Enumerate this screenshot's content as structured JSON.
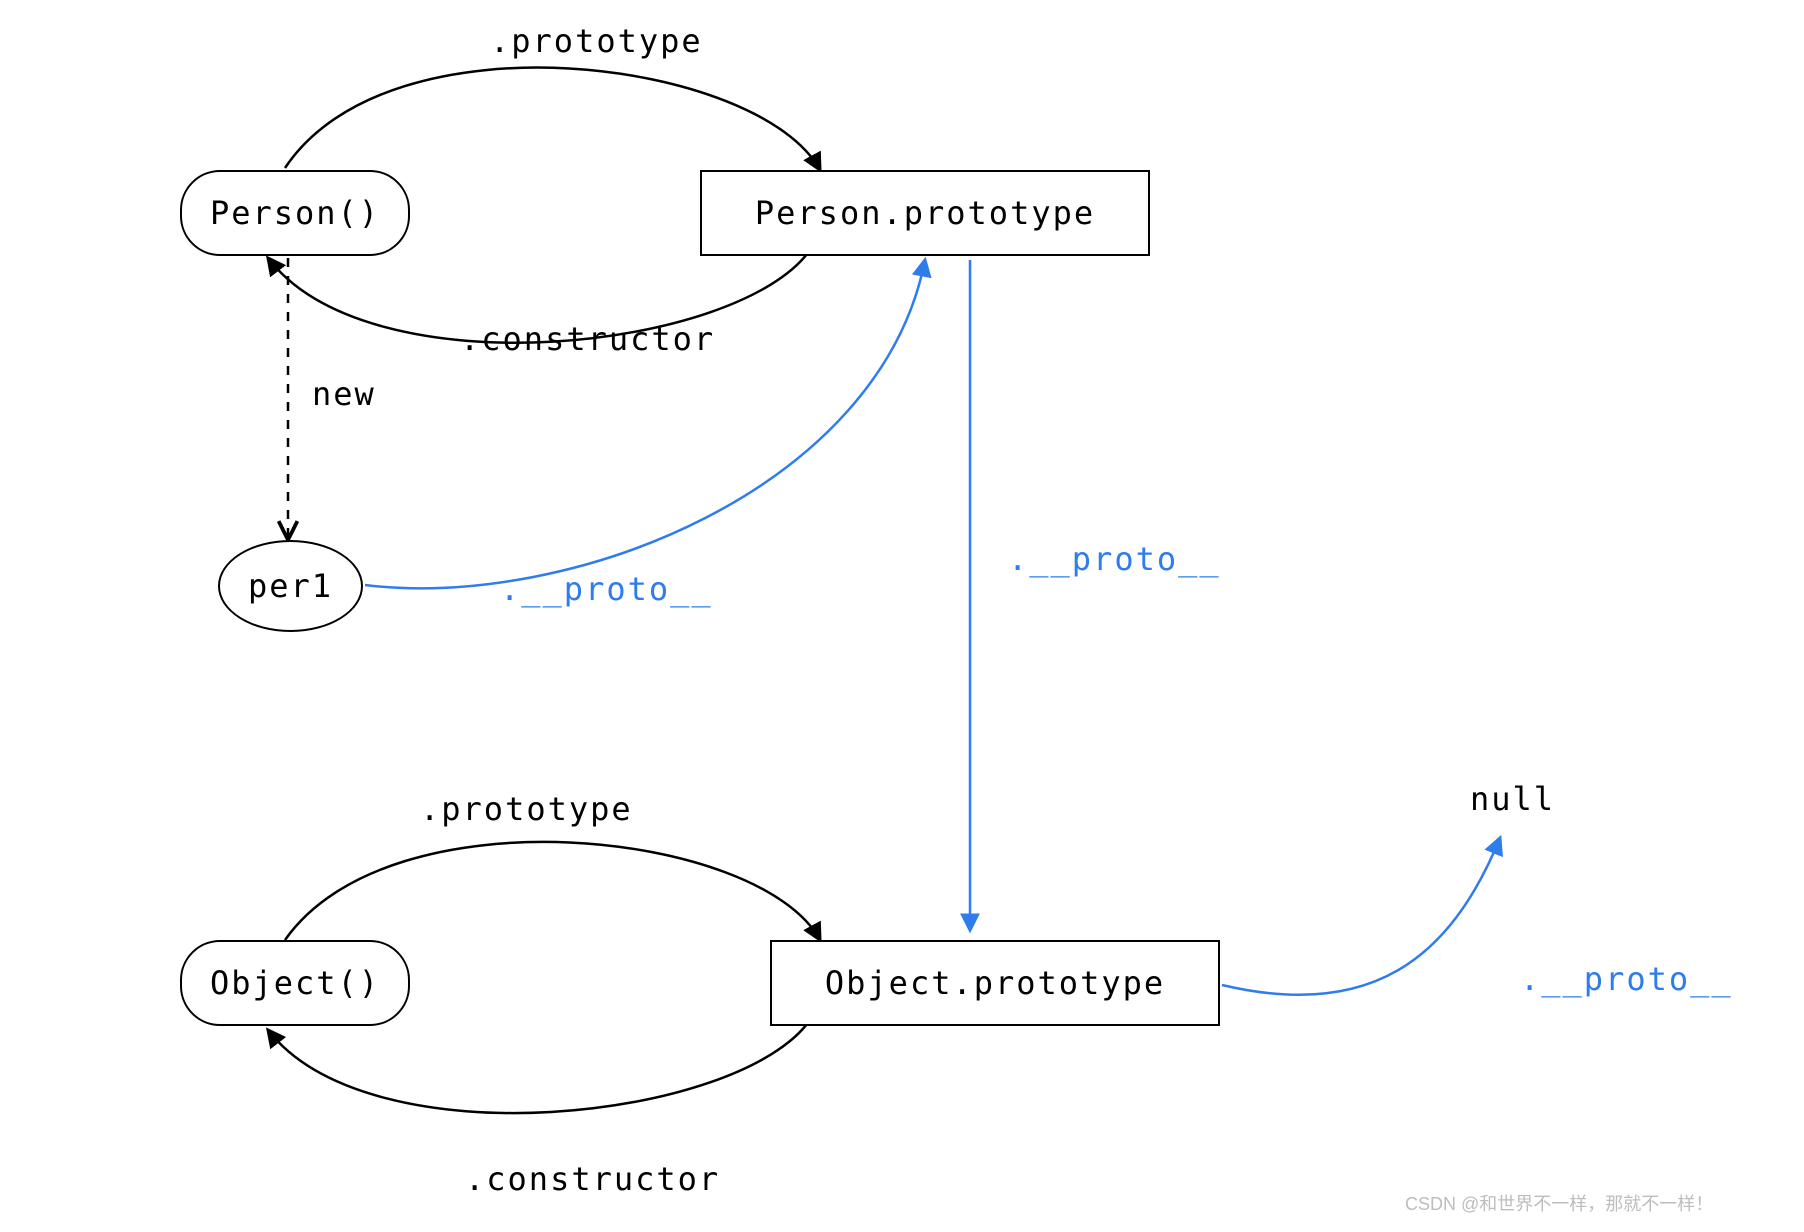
{
  "nodes": {
    "person_fn": "Person()",
    "person_proto": "Person.prototype",
    "per1": "per1",
    "object_fn": "Object()",
    "object_proto": "Object.prototype",
    "null": "null"
  },
  "labels": {
    "prototype1": ".prototype",
    "constructor1": ".constructor",
    "new": "new",
    "proto1": ".__proto__",
    "proto2": ".__proto__",
    "prototype2": ".prototype",
    "constructor2": ".constructor",
    "proto3": ".__proto__"
  },
  "colors": {
    "black": "#000000",
    "blue": "#2f7ced"
  },
  "watermark": "CSDN @和世界不一样，那就不一样！"
}
